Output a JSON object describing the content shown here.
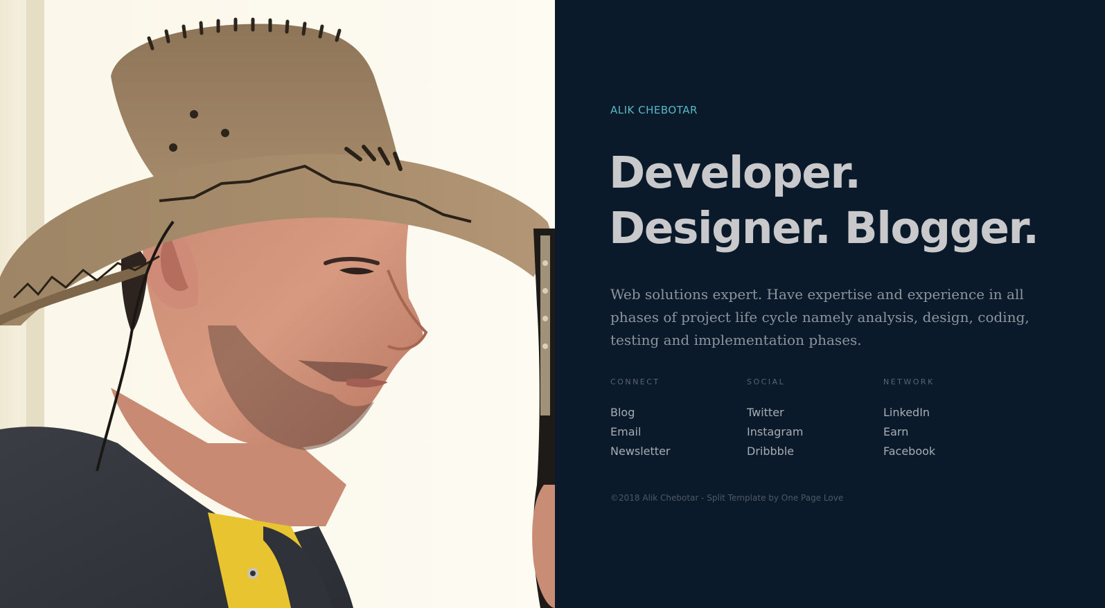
{
  "brand": {
    "name": "ALIK CHEBOTAR"
  },
  "headline": {
    "line1": "Developer.",
    "line2": "Designer. Blogger."
  },
  "intro": "Web solutions expert. Have expertise and experience in all phases of project life cycle namely analysis, design, coding, testing and implementation phases.",
  "columns": [
    {
      "title": "CONNECT",
      "items": [
        "Blog",
        "Email",
        "Newsletter"
      ]
    },
    {
      "title": "SOCIAL",
      "items": [
        "Twitter",
        "Instagram",
        "Dribbble"
      ]
    },
    {
      "title": "NETWORK",
      "items": [
        "LinkedIn",
        "Earn",
        "Facebook"
      ]
    }
  ],
  "footer": {
    "copyright": "©2018 Alik Chebotar - Split Template by ",
    "credit_link": "One Page Love"
  },
  "colors": {
    "panel_background": "#0a1a2b",
    "accent": "#5ab8c6",
    "headline": "#c9c9cc",
    "body_text": "#8e949c"
  }
}
